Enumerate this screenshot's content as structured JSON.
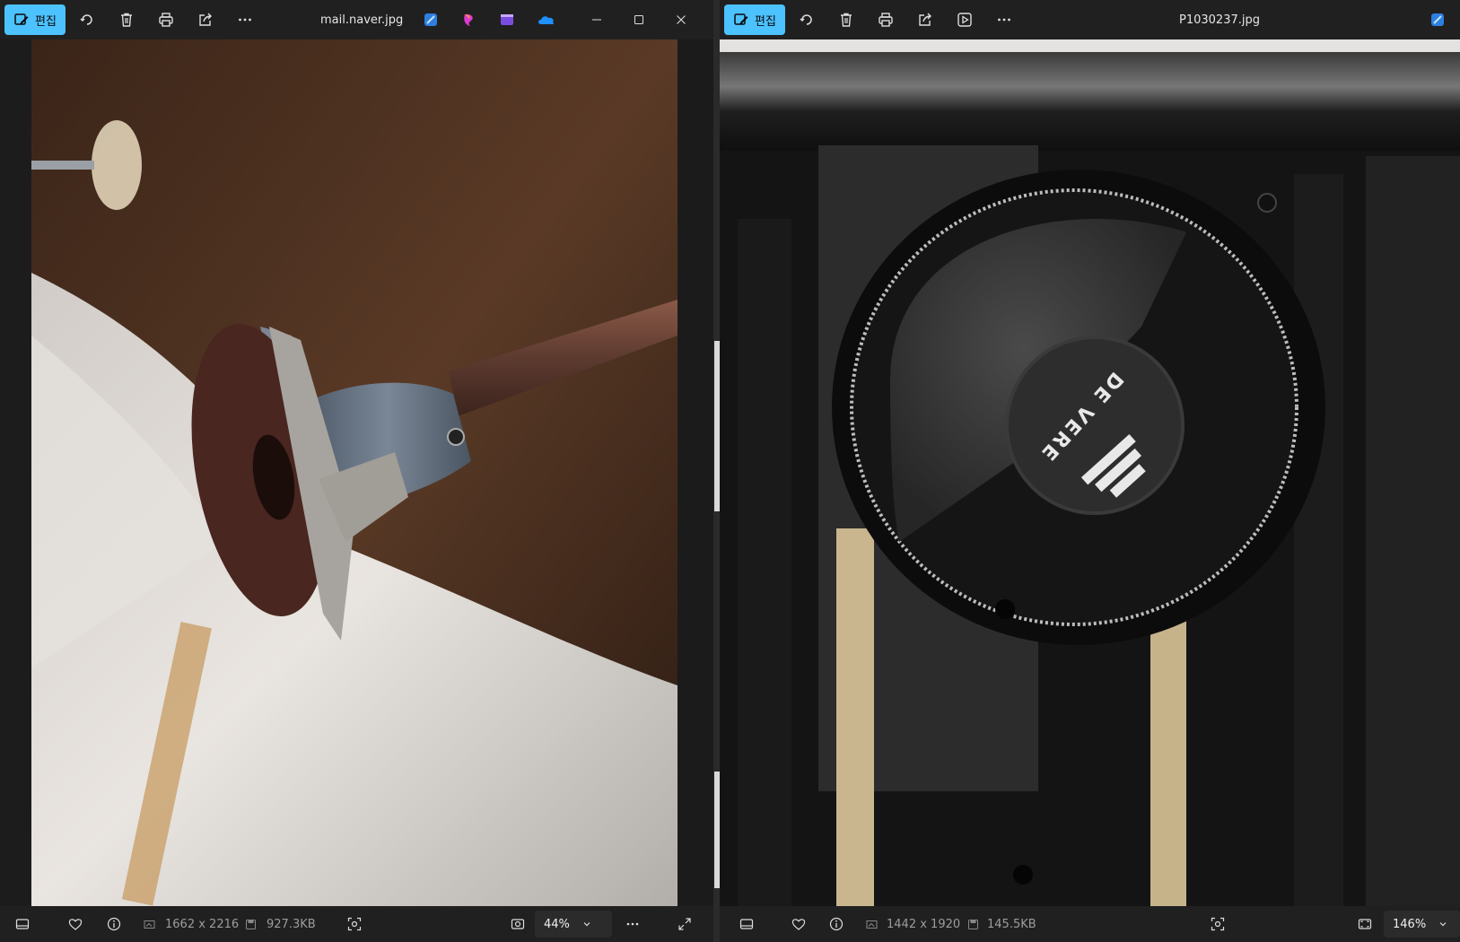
{
  "left": {
    "toolbar": {
      "edit_label": "편집"
    },
    "title": "mail.naver.jpg",
    "status": {
      "dimensions": "1662 x 2216",
      "file_size": "927.3KB",
      "zoom": "44%"
    }
  },
  "right": {
    "toolbar": {
      "edit_label": "편집"
    },
    "title": "P1030237.jpg",
    "status": {
      "dimensions": "1442 x 1920",
      "file_size": "145.5KB",
      "zoom": "146%"
    },
    "photo": {
      "logo_text": "DE VERE"
    }
  },
  "colors": {
    "accent": "#4cc2ff",
    "bar": "#202020"
  },
  "icons": [
    "edit-icon",
    "rotate-icon",
    "delete-icon",
    "print-icon",
    "share-icon",
    "slideshow-icon",
    "more-icon",
    "minimize-icon",
    "maximize-icon",
    "close-icon",
    "filmstrip-icon",
    "favorite-icon",
    "info-icon",
    "image-size-icon",
    "file-size-icon",
    "visual-search-icon",
    "actual-size-icon",
    "fit-icon",
    "chevron-down-icon",
    "fullscreen-icon"
  ]
}
